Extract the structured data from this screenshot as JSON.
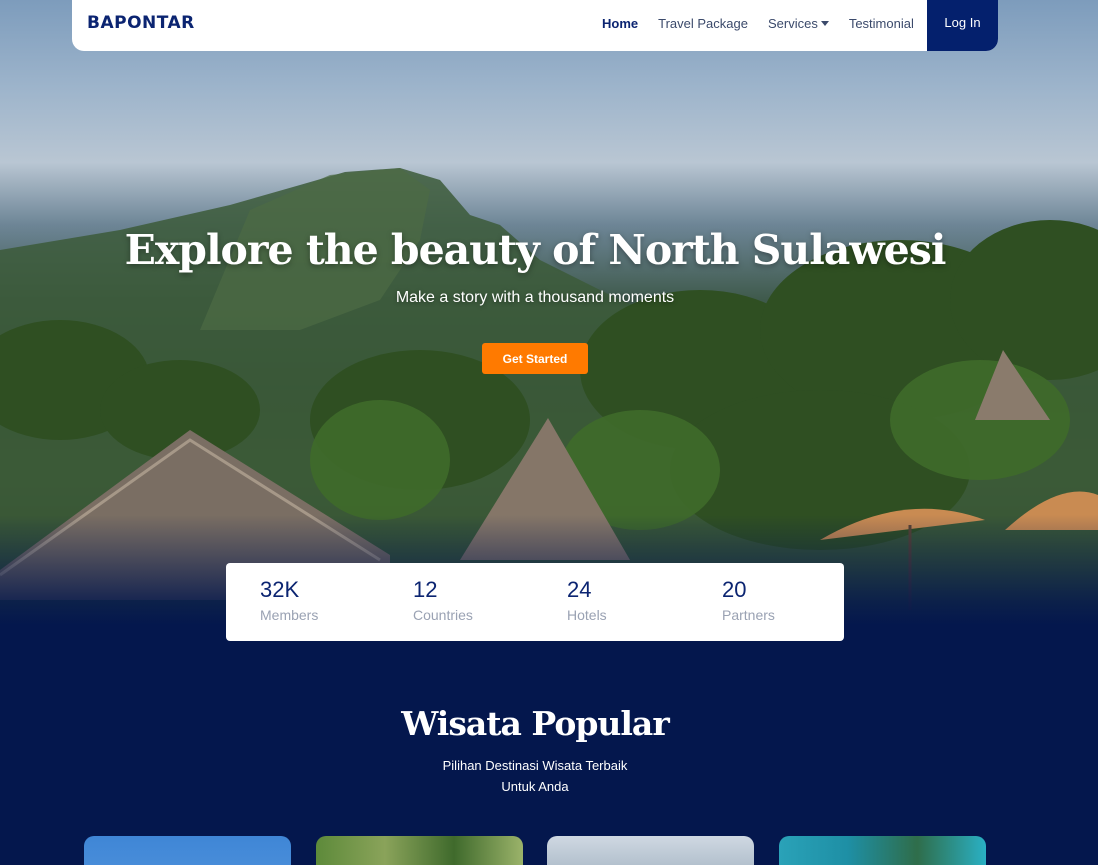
{
  "navbar": {
    "brand": "BAPONTAR",
    "links": [
      "Home",
      "Travel Package",
      "Services",
      "Testimonial"
    ],
    "login_label": "Log In"
  },
  "hero": {
    "title": "Explore the beauty of North Sulawesi",
    "subtitle": "Make a story with a thousand moments",
    "cta_label": "Get Started"
  },
  "stats": [
    {
      "value": "32K",
      "label": "Members"
    },
    {
      "value": "12",
      "label": "Countries"
    },
    {
      "value": "24",
      "label": "Hotels"
    },
    {
      "value": "20",
      "label": "Partners"
    }
  ],
  "popular": {
    "title": "Wisata Popular",
    "subtitle_line1": "Pilihan Destinasi Wisata Terbaik",
    "subtitle_line2": "Untuk Anda"
  },
  "colors": {
    "brand_navy": "#0b2471",
    "page_bg": "#04174d",
    "cta_orange": "#ff7a00"
  }
}
